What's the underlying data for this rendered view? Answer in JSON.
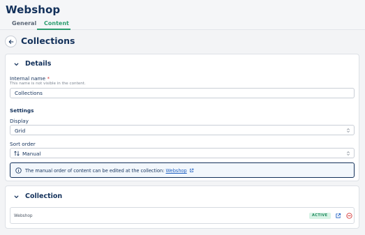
{
  "header": {
    "app_title": "Webshop",
    "tabs": [
      {
        "label": "General",
        "active": false
      },
      {
        "label": "Content",
        "active": true
      }
    ]
  },
  "page": {
    "title": "Collections"
  },
  "details": {
    "title": "Details",
    "internal_name": {
      "label": "Internal name",
      "required_mark": "*",
      "hint": "This name is not visible in the content.",
      "value": "Collections"
    },
    "settings_label": "Settings",
    "display": {
      "label": "Display",
      "value": "Grid"
    },
    "sort_order": {
      "label": "Sort order",
      "value": "Manual",
      "icon": "sort-arrows-icon"
    },
    "notice": {
      "text": "The manual order of content can be edited at the collection:",
      "link": "Webshop",
      "icon": "info-icon"
    }
  },
  "collection": {
    "title": "Collection",
    "rows": [
      {
        "name": "Webshop",
        "status": "ACTIVE"
      }
    ]
  },
  "colors": {
    "navy": "#12305a",
    "accent_green": "#2c9d6f",
    "link_blue": "#1d5fc2",
    "badge_bg": "#d8f3e6",
    "remove_red": "#d53a3a"
  }
}
